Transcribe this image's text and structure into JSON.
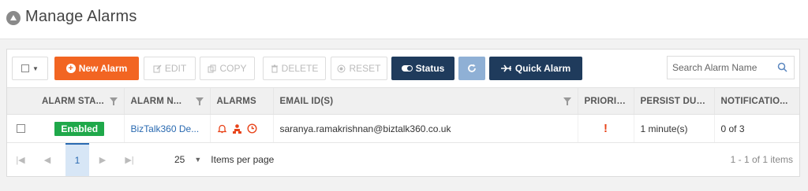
{
  "header": {
    "title": "Manage Alarms"
  },
  "toolbar": {
    "new_alarm": "New Alarm",
    "edit": "EDIT",
    "copy": "COPY",
    "delete": "DELETE",
    "reset": "RESET",
    "status": "Status",
    "quick_alarm": "Quick Alarm"
  },
  "search": {
    "placeholder": "Search Alarm Name"
  },
  "columns": {
    "alarm_status": "ALARM STA...",
    "alarm_name": "ALARM N...",
    "alarms": "ALARMS",
    "email": "EMAIL ID(S)",
    "priority": "PRIORITY",
    "persist": "PERSIST DUR...",
    "notification": "NOTIFICATIO..."
  },
  "rows": [
    {
      "status": "Enabled",
      "name": "BizTalk360 De...",
      "email": "saranya.ramakrishnan@biztalk360.co.uk",
      "priority": "!",
      "persist": "1 minute(s)",
      "notification": "0 of 3"
    }
  ],
  "pager": {
    "current_page": "1",
    "page_size": "25",
    "page_size_label": "Items per page",
    "info": "1 - 1 of 1 items"
  },
  "colors": {
    "accent_orange": "#f26522",
    "navy": "#1f3b5c",
    "enabled_green": "#1fa84a",
    "link_blue": "#2a6ab1"
  },
  "icons": [
    "logo-icon",
    "plus-icon",
    "edit-icon",
    "copy-icon",
    "delete-icon",
    "reset-icon",
    "toggle-icon",
    "refresh-icon",
    "plane-icon",
    "search-icon",
    "filter-icon",
    "bell-icon",
    "users-icon",
    "clock-icon"
  ]
}
